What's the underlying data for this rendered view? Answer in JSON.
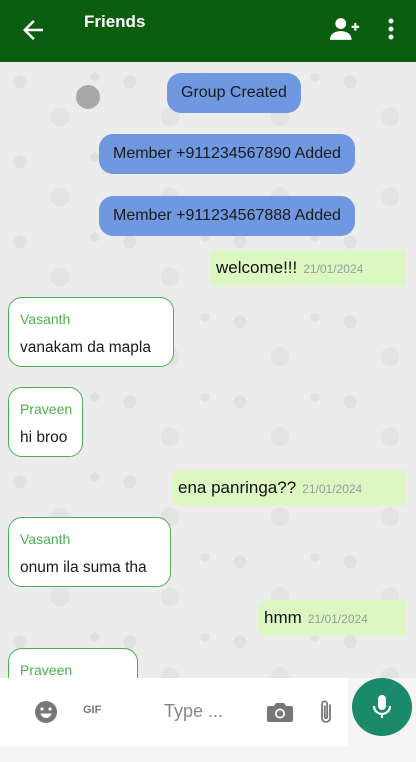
{
  "header": {
    "title": "Friends",
    "back_icon": "arrow-left-icon",
    "add_icon": "person-add-icon",
    "menu_icon": "more-vert-icon",
    "color": "#0b5d10"
  },
  "messages": {
    "system": [
      "Group Created",
      "Member +911234567890 Added",
      "Member +911234567888 Added"
    ],
    "outgoing": [
      {
        "text": "welcome!!!",
        "time": "21/01/2024"
      },
      {
        "text": "ena panringa??",
        "time": "21/01/2024"
      },
      {
        "text": "hmm",
        "time": "21/01/2024"
      }
    ],
    "incoming": [
      {
        "sender": "Vasanth",
        "text": "vanakam da mapla"
      },
      {
        "sender": "Praveen",
        "text": "hi broo"
      },
      {
        "sender": "Vasanth",
        "text": "onum ila suma tha"
      },
      {
        "sender": "Praveen",
        "text": ""
      }
    ]
  },
  "input": {
    "placeholder": "Type ...",
    "gif_label": "GIF"
  },
  "colors": {
    "system_bubble": "#6f98e0",
    "outgoing_bubble": "#ddf7c3",
    "incoming_border": "#4caf50",
    "mic_button": "#1a8a6a"
  }
}
